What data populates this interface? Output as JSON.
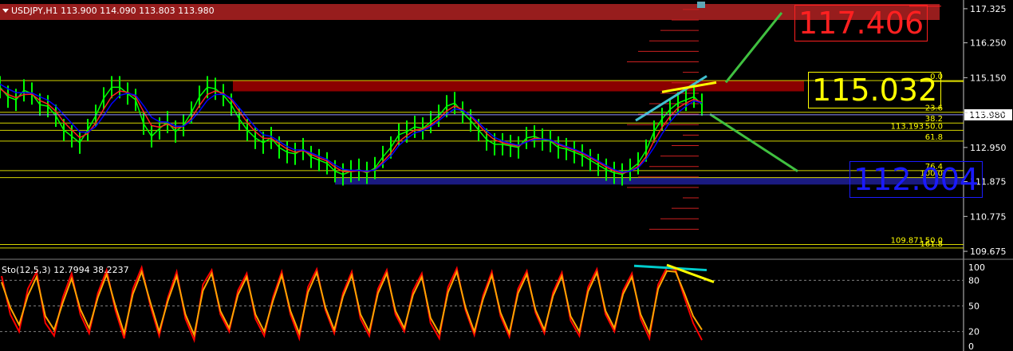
{
  "title": {
    "symbol": "USDJPY,H1",
    "ohlc": "113.900 114.090 113.803 113.980"
  },
  "targets": {
    "upper": "117.406",
    "middle": "115.032",
    "lower": "112.004"
  },
  "stochastic_title": "Sto(12,5,3) 12.7994 38.2237",
  "chart_data": [
    {
      "type": "line",
      "series": [
        {
          "color": "#00ff00"
        },
        {
          "color": "#ff2020"
        },
        {
          "color": "#0000ff"
        }
      ],
      "x": [
        0,
        10,
        20,
        30,
        40,
        50,
        60,
        70,
        80,
        90,
        100,
        110,
        120,
        130,
        140,
        150,
        160,
        170,
        180,
        190,
        200,
        210,
        220,
        230,
        240,
        250,
        260,
        270,
        280,
        290,
        300,
        310,
        320,
        330,
        340,
        350,
        360,
        370,
        380,
        390,
        400,
        410,
        420,
        430,
        440,
        450,
        460,
        470,
        480,
        490,
        500,
        510,
        520,
        530,
        540,
        550,
        560,
        570,
        580,
        590,
        600,
        610,
        620,
        630,
        640,
        650,
        660,
        670,
        680,
        690,
        700,
        710,
        720,
        730,
        740,
        750,
        760,
        770,
        780,
        790,
        800,
        810,
        820,
        830,
        840,
        850,
        860,
        870,
        880
      ],
      "close": [
        114.85,
        114.55,
        114.45,
        114.75,
        114.65,
        114.3,
        114.25,
        113.95,
        113.5,
        113.3,
        113.1,
        113.5,
        113.95,
        114.5,
        114.85,
        114.85,
        114.65,
        114.45,
        113.7,
        113.3,
        113.55,
        113.75,
        113.45,
        113.65,
        114.05,
        114.55,
        114.85,
        114.8,
        114.6,
        114.3,
        113.85,
        113.5,
        113.25,
        113.1,
        113.25,
        112.95,
        112.8,
        112.75,
        112.9,
        112.65,
        112.55,
        112.45,
        112.2,
        112.1,
        112.2,
        112.25,
        112.15,
        112.3,
        112.65,
        112.95,
        113.35,
        113.45,
        113.6,
        113.55,
        113.75,
        113.95,
        114.25,
        114.35,
        114.05,
        113.8,
        113.5,
        113.2,
        113.05,
        113.05,
        113.0,
        112.95,
        113.25,
        113.3,
        113.2,
        113.15,
        112.95,
        112.9,
        112.8,
        112.7,
        112.55,
        112.4,
        112.25,
        112.15,
        112.1,
        112.25,
        112.45,
        112.85,
        113.45,
        113.85,
        114.15,
        114.35,
        114.45,
        114.55,
        114.3
      ],
      "ema_fast": [
        114.8,
        114.62,
        114.52,
        114.62,
        114.63,
        114.43,
        114.32,
        114.09,
        113.75,
        113.5,
        113.26,
        113.39,
        113.72,
        114.16,
        114.56,
        114.73,
        114.69,
        114.55,
        114.08,
        113.64,
        113.59,
        113.69,
        113.56,
        113.61,
        113.88,
        114.27,
        114.62,
        114.73,
        114.66,
        114.45,
        114.09,
        113.74,
        113.45,
        113.24,
        113.24,
        113.07,
        112.9,
        112.8,
        112.85,
        112.73,
        112.62,
        112.52,
        112.33,
        112.19,
        112.19,
        112.22,
        112.18,
        112.25,
        112.5,
        112.77,
        113.13,
        113.33,
        113.5,
        113.53,
        113.66,
        113.85,
        114.1,
        114.26,
        114.14,
        113.94,
        113.67,
        113.39,
        113.19,
        113.1,
        113.04,
        112.99,
        113.14,
        113.24,
        113.22,
        113.18,
        113.04,
        112.95,
        112.86,
        112.76,
        112.63,
        112.48,
        112.33,
        112.21,
        112.14,
        112.2,
        112.35,
        112.66,
        113.16,
        113.58,
        113.93,
        114.2,
        114.35,
        114.47,
        114.37
      ],
      "ema_slow": [
        114.95,
        114.8,
        114.68,
        114.68,
        114.67,
        114.55,
        114.44,
        114.25,
        113.98,
        113.71,
        113.44,
        113.43,
        113.61,
        113.95,
        114.33,
        114.59,
        114.66,
        114.6,
        114.27,
        113.9,
        113.76,
        113.75,
        113.62,
        113.62,
        113.8,
        114.1,
        114.44,
        114.62,
        114.63,
        114.5,
        114.2,
        113.89,
        113.59,
        113.35,
        113.3,
        113.14,
        112.98,
        112.87,
        112.87,
        112.78,
        112.67,
        112.57,
        112.4,
        112.26,
        112.23,
        112.23,
        112.2,
        112.24,
        112.44,
        112.68,
        113.01,
        113.23,
        113.41,
        113.48,
        113.61,
        113.79,
        114.0,
        114.17,
        114.12,
        113.96,
        113.74,
        113.48,
        113.27,
        113.15,
        113.08,
        113.02,
        113.12,
        113.2,
        113.21,
        113.19,
        113.07,
        112.98,
        112.89,
        112.79,
        112.66,
        112.52,
        112.38,
        112.25,
        112.17,
        112.2,
        112.31,
        112.58,
        112.95,
        113.38,
        113.75,
        114.05,
        114.25,
        114.42,
        114.35
      ],
      "ylim": [
        109.5,
        117.6
      ],
      "y_ticks": [
        "117.325",
        "116.250",
        "115.150",
        "114.050",
        "112.950",
        "111.875",
        "110.775",
        "109.675"
      ],
      "current_price": "113.980",
      "resistance_zone": [
        114.72,
        115.05
      ],
      "support_zone": [
        111.78,
        112.0
      ],
      "fibonacci": [
        {
          "label": "0.0",
          "price": 115.06
        },
        {
          "label": "23.6",
          "price": 114.06
        },
        {
          "label": "38.2",
          "price": 113.72
        },
        {
          "label": "50.0",
          "price": 113.49,
          "price_label": "113.193"
        },
        {
          "label": "61.8",
          "price": 113.15
        },
        {
          "label": "76.4",
          "price": 112.22
        },
        {
          "label": "100.0",
          "price": 112.0
        },
        {
          "label": "50.0",
          "price": 109.89,
          "price_label": "109.871"
        },
        {
          "label": "161.8",
          "price": 109.78
        }
      ],
      "target_levels": {
        "upper": 117.406,
        "middle": 115.032,
        "lower": 112.004
      }
    },
    {
      "type": "line",
      "name": "Stochastic",
      "series": [
        {
          "color": "#ff0000"
        },
        {
          "color": "#ffa500"
        }
      ],
      "ylim": [
        0,
        100
      ],
      "y_ticks": [
        "100",
        "80",
        "50",
        "20",
        "0"
      ],
      "levels": [
        80,
        50,
        20
      ],
      "k": [
        85,
        40,
        20,
        70,
        90,
        30,
        15,
        60,
        88,
        40,
        18,
        65,
        92,
        45,
        12,
        70,
        95,
        50,
        15,
        60,
        90,
        35,
        10,
        75,
        92,
        40,
        20,
        68,
        88,
        35,
        15,
        60,
        90,
        40,
        12,
        72,
        93,
        45,
        18,
        65,
        90,
        35,
        15,
        70,
        92,
        40,
        20,
        68,
        88,
        30,
        12,
        72,
        94,
        45,
        16,
        62,
        90,
        38,
        14,
        70,
        91,
        42,
        18,
        66,
        89,
        33,
        15,
        72,
        93,
        40,
        20,
        68,
        88,
        35,
        12,
        75,
        95,
        92,
        60,
        30,
        10
      ],
      "d": [
        78,
        48,
        28,
        62,
        84,
        38,
        22,
        54,
        82,
        46,
        24,
        60,
        87,
        50,
        18,
        64,
        90,
        54,
        20,
        56,
        85,
        40,
        16,
        68,
        88,
        44,
        24,
        63,
        84,
        40,
        20,
        56,
        86,
        44,
        18,
        66,
        89,
        48,
        22,
        61,
        86,
        40,
        20,
        65,
        88,
        44,
        24,
        63,
        84,
        36,
        18,
        66,
        90,
        48,
        20,
        58,
        86,
        42,
        18,
        65,
        87,
        45,
        22,
        62,
        85,
        38,
        20,
        67,
        89,
        44,
        24,
        64,
        84,
        40,
        18,
        70,
        91,
        90,
        65,
        38,
        22
      ],
      "trend_lines": [
        {
          "label": "divergence-top",
          "color": "#00cccc"
        },
        {
          "label": "divergence-down",
          "color": "#ffff00"
        }
      ]
    }
  ]
}
